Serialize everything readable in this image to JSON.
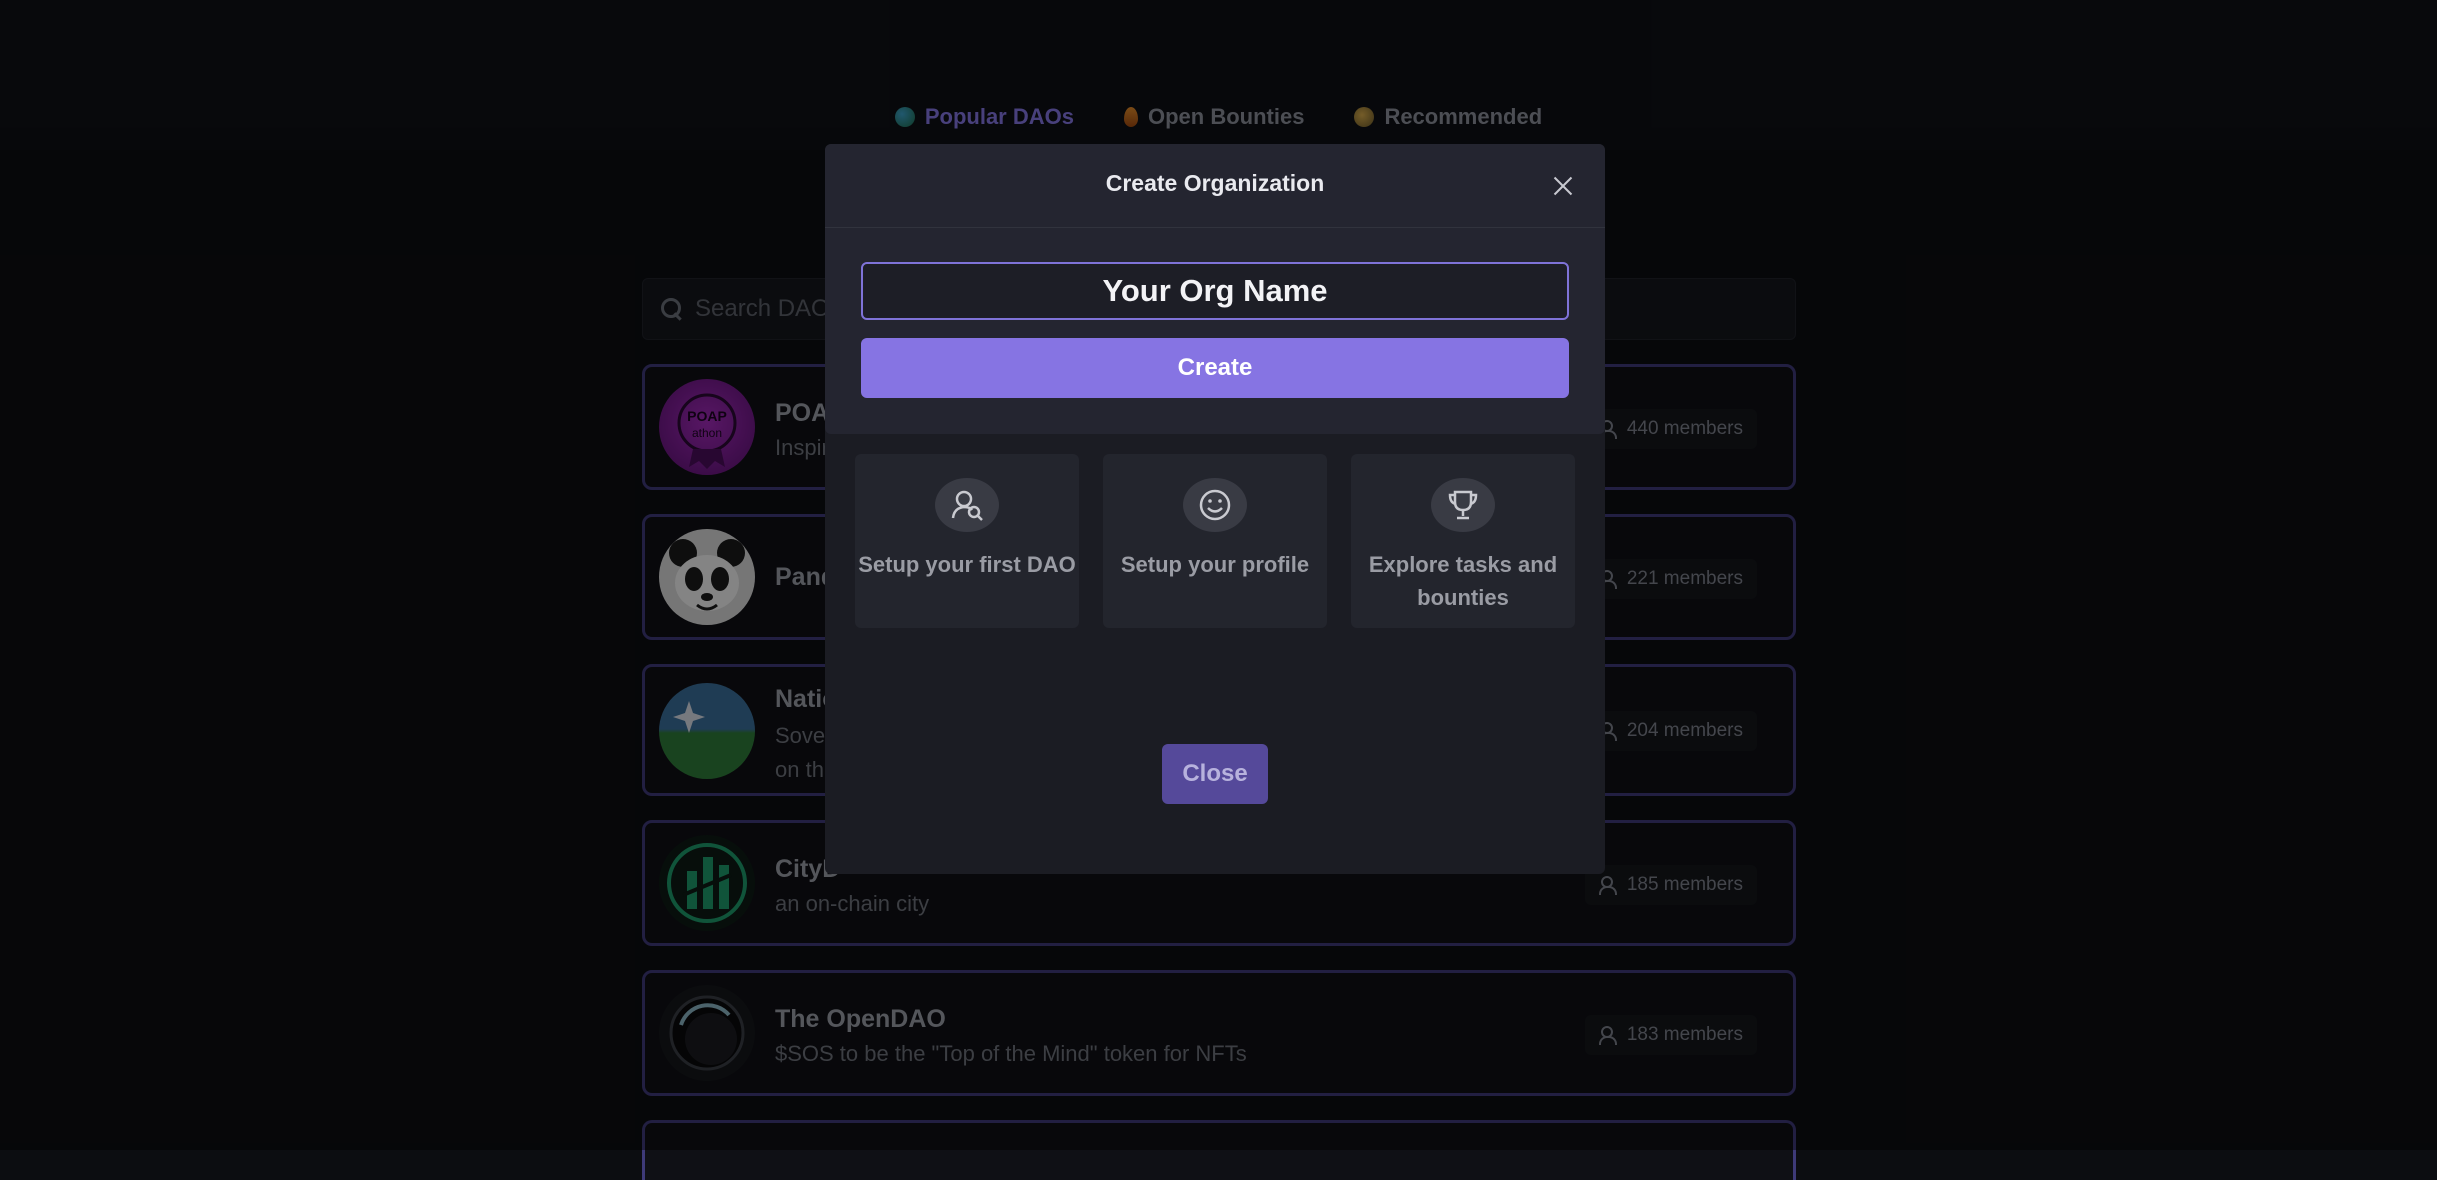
{
  "tabs": [
    {
      "label": "Popular DAOs",
      "icon": "globe-icon",
      "color": "#2e8b57",
      "active": true
    },
    {
      "label": "Open Bounties",
      "icon": "fire-icon",
      "color": "#c06a1c",
      "active": false
    },
    {
      "label": "Recommended",
      "icon": "star-icon",
      "color": "#b58a2a",
      "active": false
    }
  ],
  "search": {
    "placeholder": "Search DAOs"
  },
  "daos": [
    {
      "name": "POA",
      "description": "Inspir",
      "members": "440 members"
    },
    {
      "name": "Pand",
      "description": "",
      "members": "221 members"
    },
    {
      "name": "Natio",
      "description": "Sover",
      "description2": "on th",
      "members": "204 members"
    },
    {
      "name": "CityD",
      "description": "an on-chain city",
      "members": "185 members"
    },
    {
      "name": "The OpenDAO",
      "description": "$SOS to be the \"Top of the Mind\" token for NFTs",
      "members": "183 members"
    }
  ],
  "onboarding": {
    "cards": [
      {
        "label": "Setup your first DAO",
        "icon": "user-search-icon"
      },
      {
        "label": "Setup your profile",
        "icon": "smiley-icon"
      },
      {
        "label": "Explore tasks and bounties",
        "icon": "trophy-icon"
      }
    ],
    "close_label": "Close"
  },
  "modal": {
    "title": "Create Organization",
    "input_value": "Your Org Name",
    "create_label": "Create"
  },
  "colors": {
    "accent": "#8674e3",
    "card_border": "#3e3a78",
    "background": "#0c0d11"
  }
}
